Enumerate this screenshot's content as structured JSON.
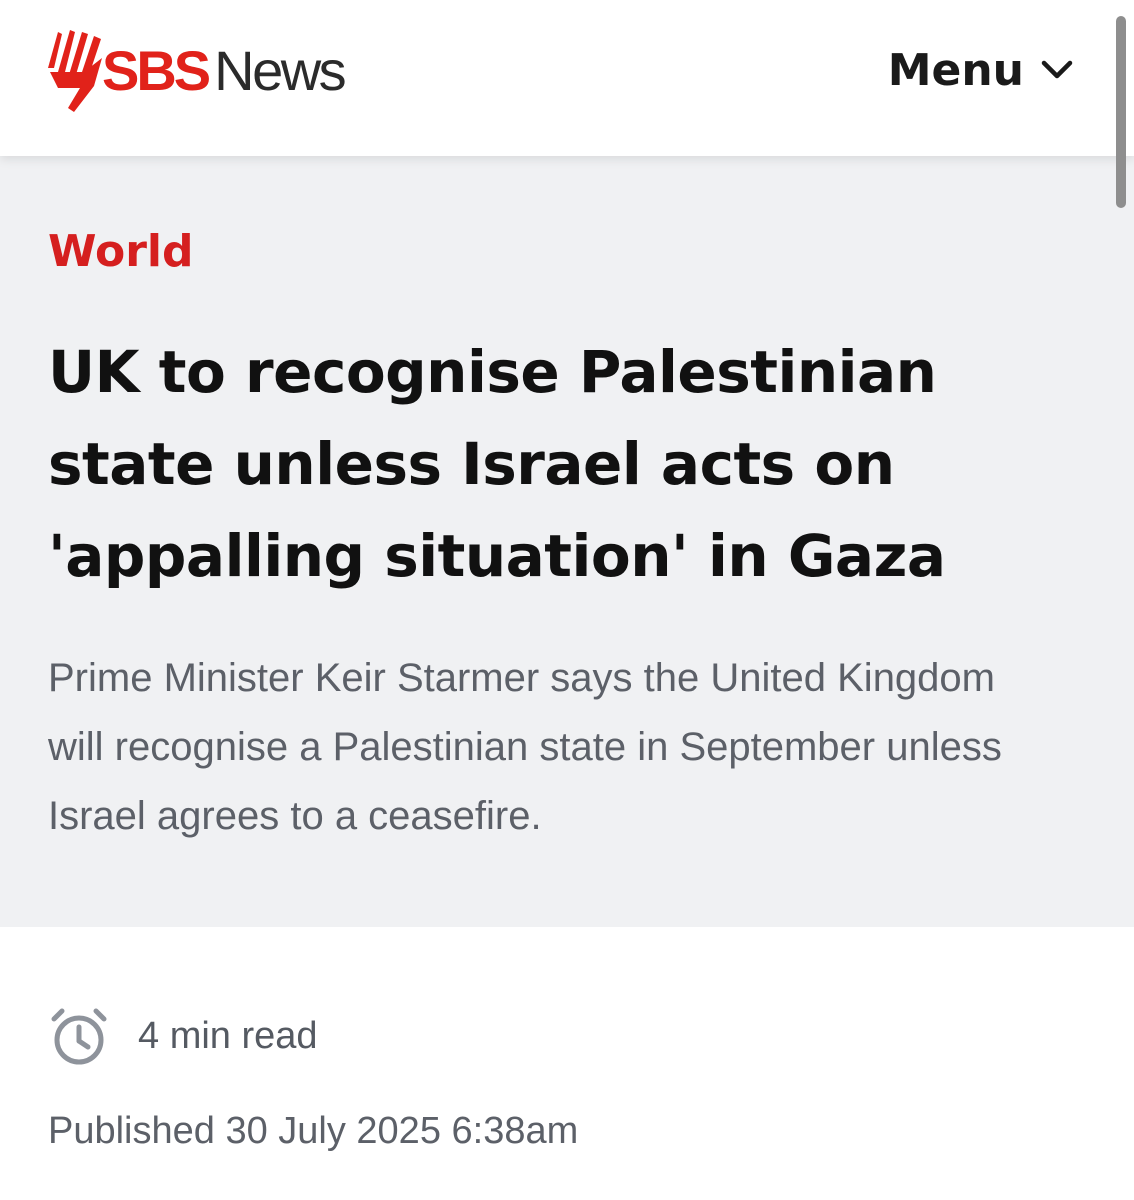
{
  "header": {
    "logo_sbs": "SBS",
    "logo_news": "News",
    "menu_label": "Menu",
    "menu_icon": "chevron-down-icon"
  },
  "article": {
    "category": "World",
    "headline": "UK to recognise Palestinian state unless Israel acts on 'appalling situation' in Gaza",
    "standfirst": "Prime Minister Keir Starmer says the United Kingdom will recognise a Palestinian state in September unless Israel agrees to a ceasefire.",
    "read_time": "4 min read",
    "read_time_icon": "clock-icon",
    "published": "Published 30 July 2025 6:38am"
  },
  "colors": {
    "brand_red": "#e1221a",
    "category_red": "#d51f1f",
    "hero_background": "#f0f1f3",
    "headline_text": "#111111",
    "muted_text": "#5c6068"
  }
}
